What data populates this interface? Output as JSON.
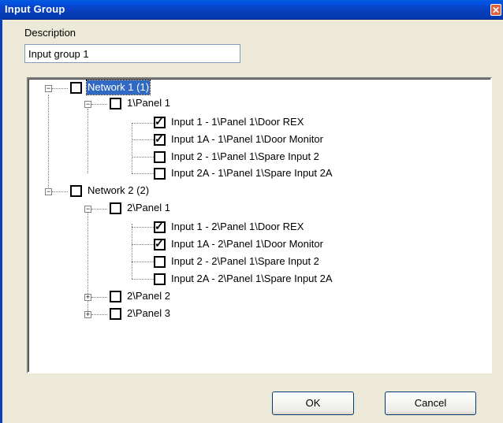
{
  "window": {
    "title": "Input Group",
    "close_glyph": "✕"
  },
  "description": {
    "label": "Description",
    "value": "Input group 1"
  },
  "tree": {
    "network1": {
      "label": "Network 1 (1)",
      "checked": false,
      "selected": true,
      "panel1": {
        "label": "1\\Panel 1",
        "checked": false,
        "inputs": [
          {
            "label": "Input 1 - 1\\Panel 1\\Door REX",
            "checked": true
          },
          {
            "label": "Input 1A - 1\\Panel 1\\Door Monitor",
            "checked": true
          },
          {
            "label": "Input 2 - 1\\Panel 1\\Spare Input 2",
            "checked": false
          },
          {
            "label": "Input 2A - 1\\Panel 1\\Spare Input 2A",
            "checked": false
          }
        ]
      }
    },
    "network2": {
      "label": "Network 2 (2)",
      "checked": false,
      "panel1": {
        "label": "2\\Panel 1",
        "checked": false,
        "inputs": [
          {
            "label": "Input 1 - 2\\Panel 1\\Door REX",
            "checked": true
          },
          {
            "label": "Input 1A - 2\\Panel 1\\Door Monitor",
            "checked": true
          },
          {
            "label": "Input 2 - 2\\Panel 1\\Spare Input 2",
            "checked": false
          },
          {
            "label": "Input 2A - 2\\Panel 1\\Spare Input 2A",
            "checked": false
          }
        ]
      },
      "panel2": {
        "label": "2\\Panel 2",
        "checked": false
      },
      "panel3": {
        "label": "2\\Panel 3",
        "checked": false
      }
    },
    "expand_glyph": "+",
    "collapse_glyph": "−",
    "check_glyph": "✓"
  },
  "buttons": {
    "ok": "OK",
    "cancel": "Cancel"
  }
}
